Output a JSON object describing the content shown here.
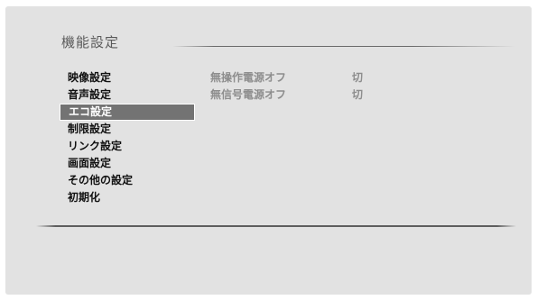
{
  "header": {
    "title": "機能設定"
  },
  "menu": {
    "items": [
      {
        "label": "映像設定"
      },
      {
        "label": "音声設定"
      },
      {
        "label": "エコ設定"
      },
      {
        "label": "制限設定"
      },
      {
        "label": "リンク設定"
      },
      {
        "label": "画面設定"
      },
      {
        "label": "その他の設定"
      },
      {
        "label": "初期化"
      }
    ],
    "selected_label": "エコ設定"
  },
  "settings": {
    "rows": [
      {
        "label": "無操作電源オフ",
        "value": "切"
      },
      {
        "label": "無信号電源オフ",
        "value": "切"
      }
    ]
  },
  "colors": {
    "background": "#e2e2e2",
    "selected_highlight": "#737373",
    "dimmed_text": "#8d8d8d"
  }
}
